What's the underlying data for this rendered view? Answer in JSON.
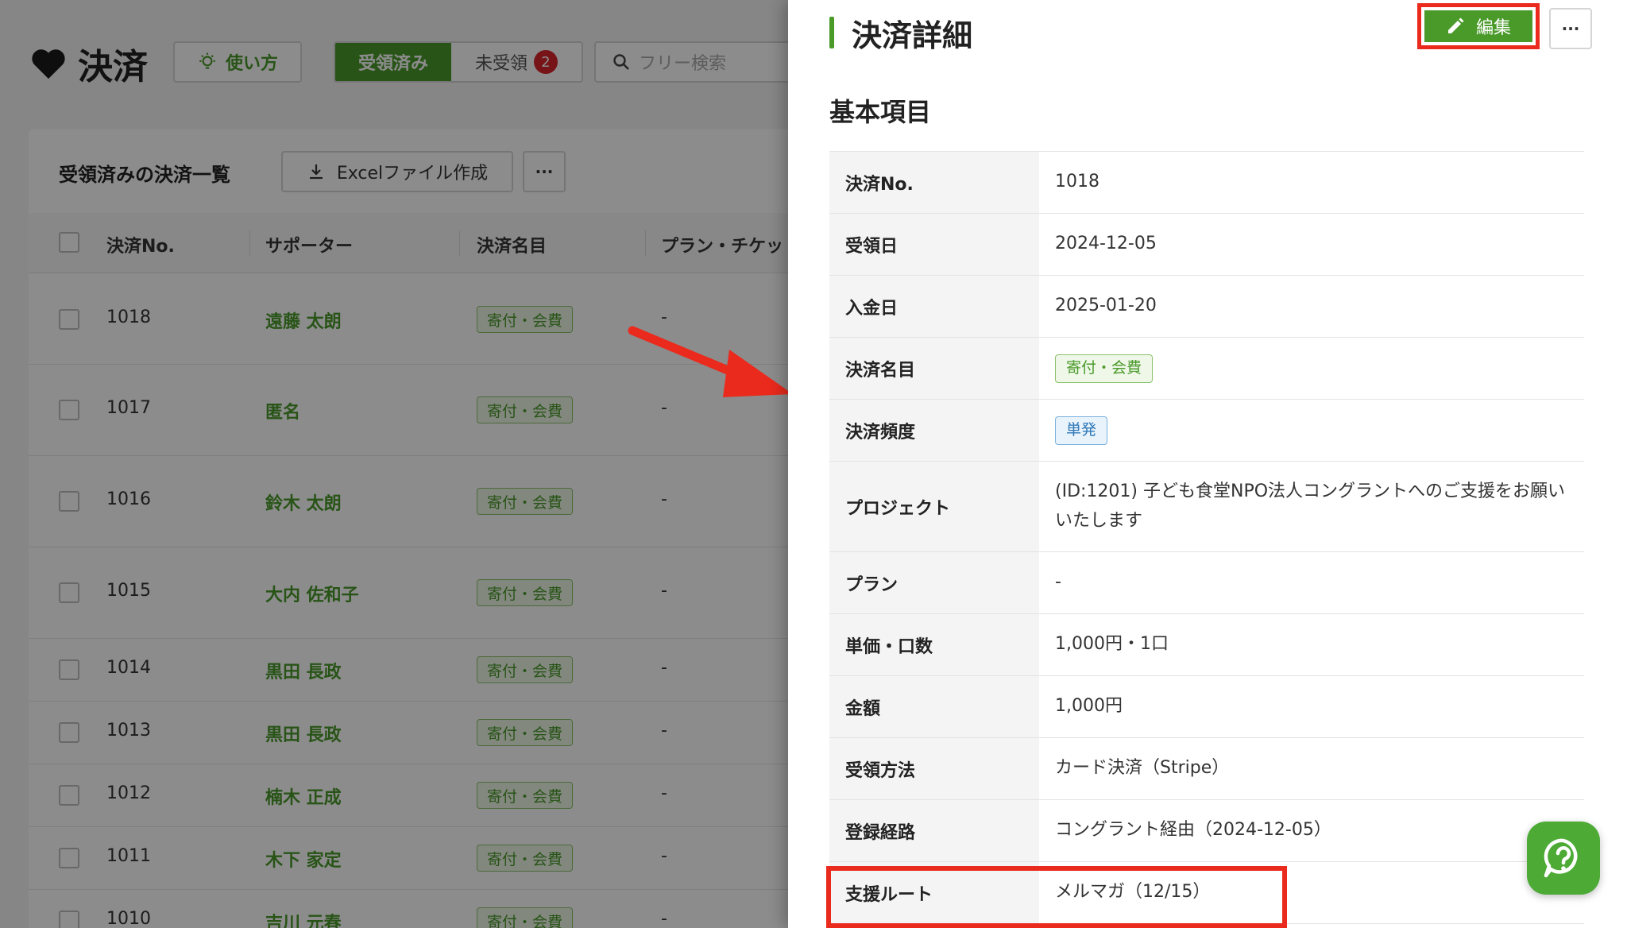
{
  "page": {
    "title": "決済",
    "howto_label": "使い方",
    "tabs": {
      "received": "受領済み",
      "unreceived": "未受領",
      "unreceived_count": "2"
    },
    "search_placeholder": "フリー検索"
  },
  "list": {
    "heading": "受領済みの決済一覧",
    "excel_label": "Excelファイル作成",
    "more_label": "···",
    "columns": [
      "決済No.",
      "サポーター",
      "決済名目",
      "プラン・チケッ"
    ],
    "rows": [
      {
        "no": "1018",
        "supporter": "遠藤 太朗",
        "tag": "寄付・会費",
        "plan": "-"
      },
      {
        "no": "1017",
        "supporter": "匿名",
        "tag": "寄付・会費",
        "plan": "-"
      },
      {
        "no": "1016",
        "supporter": "鈴木 太朗",
        "tag": "寄付・会費",
        "plan": "-"
      },
      {
        "no": "1015",
        "supporter": "大内 佐和子",
        "tag": "寄付・会費",
        "plan": "-"
      },
      {
        "no": "1014",
        "supporter": "黒田 長政",
        "tag": "寄付・会費",
        "plan": "-"
      },
      {
        "no": "1013",
        "supporter": "黒田 長政",
        "tag": "寄付・会費",
        "plan": "-"
      },
      {
        "no": "1012",
        "supporter": "楠木 正成",
        "tag": "寄付・会費",
        "plan": "-"
      },
      {
        "no": "1011",
        "supporter": "木下 家定",
        "tag": "寄付・会費",
        "plan": "-"
      },
      {
        "no": "1010",
        "supporter": "吉川 元春",
        "tag": "寄付・会費",
        "plan": "-"
      }
    ]
  },
  "detail": {
    "title": "決済詳細",
    "edit_label": "編集",
    "more_label": "···",
    "section_title": "基本項目",
    "fields": [
      {
        "label": "決済No.",
        "value": "1018"
      },
      {
        "label": "受領日",
        "value": "2024-12-05"
      },
      {
        "label": "入金日",
        "value": "2025-01-20"
      },
      {
        "label": "決済名目",
        "value": "寄付・会費"
      },
      {
        "label": "決済頻度",
        "value": "単発"
      },
      {
        "label": "プロジェクト",
        "value": "(ID:1201) 子ども食堂NPO法人コングラントへのご支援をお願いいたします"
      },
      {
        "label": "プラン",
        "value": "-"
      },
      {
        "label": "単価・口数",
        "value": "1,000円・1口"
      },
      {
        "label": "金額",
        "value": "1,000円"
      },
      {
        "label": "受領方法",
        "value": "カード決済（Stripe）"
      },
      {
        "label": "登録経路",
        "value": "コングラント経由（2024-12-05）"
      },
      {
        "label": "支援ルート",
        "value": "メルマガ（12/15）"
      }
    ]
  },
  "icons": {
    "heart": "heart-icon",
    "bulb": "lightbulb-icon",
    "search": "search-icon",
    "download": "download-icon",
    "pencil": "pencil-icon",
    "help": "help-icon"
  },
  "colors": {
    "brand_green": "#4a9a2a",
    "badge_red": "#d9262a",
    "annotation_red": "#ea2a1d",
    "tag_blue": "#2e78b7"
  }
}
